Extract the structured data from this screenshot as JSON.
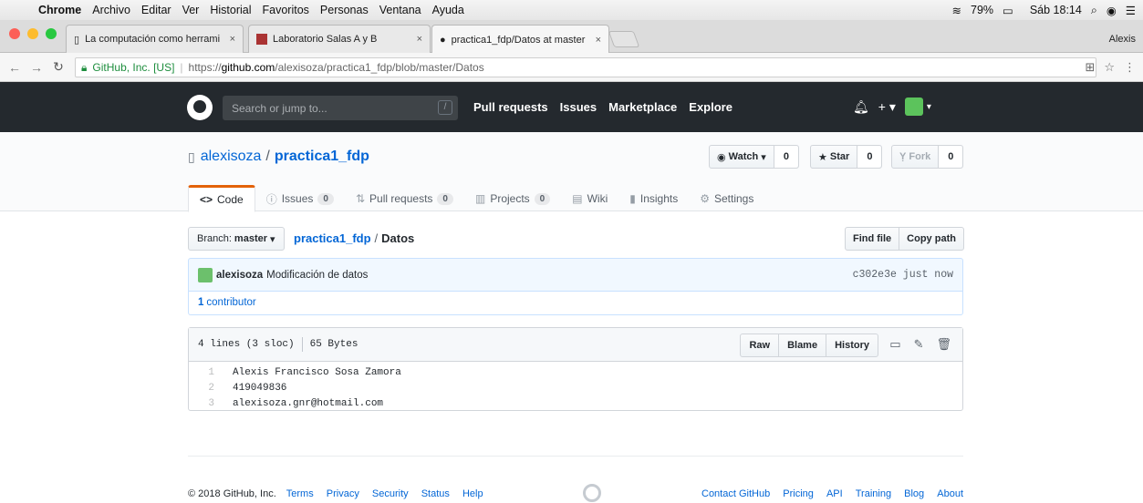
{
  "mac_menu": {
    "app": "Chrome",
    "items": [
      "Archivo",
      "Editar",
      "Ver",
      "Historial",
      "Favoritos",
      "Personas",
      "Ventana",
      "Ayuda"
    ],
    "battery": "79%",
    "clock": "Sáb 18:14"
  },
  "tabs": [
    {
      "title": "La computación como herrami",
      "active": false
    },
    {
      "title": "Laboratorio Salas A y B",
      "active": false
    },
    {
      "title": "practica1_fdp/Datos at master",
      "active": true
    }
  ],
  "profile_name": "Alexis",
  "address": {
    "secure_label": "GitHub, Inc. [US]",
    "scheme": "https://",
    "host": "github.com",
    "path": "/alexisoza/practica1_fdp/blob/master/Datos"
  },
  "github_header": {
    "search_placeholder": "Search or jump to...",
    "search_key": "/",
    "nav": [
      "Pull requests",
      "Issues",
      "Marketplace",
      "Explore"
    ]
  },
  "repo": {
    "owner": "alexisoza",
    "name": "practica1_fdp",
    "watch_label": "Watch",
    "watch_count": "0",
    "star_label": "Star",
    "star_count": "0",
    "fork_label": "Fork",
    "fork_count": "0",
    "tabs": [
      {
        "label": "Code",
        "icon": "<>",
        "count": null
      },
      {
        "label": "Issues",
        "icon": "ⓘ",
        "count": "0"
      },
      {
        "label": "Pull requests",
        "icon": "⇅",
        "count": "0"
      },
      {
        "label": "Projects",
        "icon": "▥",
        "count": "0"
      },
      {
        "label": "Wiki",
        "icon": "▤",
        "count": null
      },
      {
        "label": "Insights",
        "icon": "▮",
        "count": null
      },
      {
        "label": "Settings",
        "icon": "⚙",
        "count": null
      }
    ]
  },
  "file_nav": {
    "branch_label": "Branch:",
    "branch": "master",
    "repo_link": "practica1_fdp",
    "separator": "/",
    "file": "Datos",
    "find_file": "Find file",
    "copy_path": "Copy path"
  },
  "commit": {
    "author": "alexisoza",
    "message": "Modificación de datos",
    "sha_time": "c302e3e just now",
    "contributors_count": "1",
    "contributors_label": "contributor"
  },
  "file": {
    "lines_info": "4 lines (3 sloc)",
    "size": "65 Bytes",
    "raw": "Raw",
    "blame": "Blame",
    "history": "History",
    "lines": [
      {
        "n": "1",
        "text": "Alexis Francisco Sosa Zamora"
      },
      {
        "n": "2",
        "text": "419049836"
      },
      {
        "n": "3",
        "text": "alexisoza.gnr@hotmail.com"
      }
    ]
  },
  "footer": {
    "copyright": "© 2018 GitHub, Inc.",
    "left_links": [
      "Terms",
      "Privacy",
      "Security",
      "Status",
      "Help"
    ],
    "right_links": [
      "Contact GitHub",
      "Pricing",
      "API",
      "Training",
      "Blog",
      "About"
    ]
  }
}
